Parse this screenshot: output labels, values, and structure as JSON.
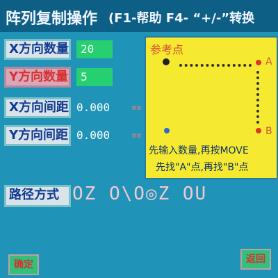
{
  "title": {
    "main": "阵列复制操作",
    "help": "(F1-帮助  F4- “+/-”转换"
  },
  "fields": [
    {
      "label": "X方向数量",
      "value": "20"
    },
    {
      "label": "Y方向数量",
      "value": "5"
    },
    {
      "label": "X方向间距",
      "value": "0.000",
      "unit": "mm"
    },
    {
      "label": "Y方向间距",
      "value": "0.000",
      "unit": "mm"
    }
  ],
  "path": {
    "label": "路径方式",
    "glyphs": "OZ O\\O◎Z OU"
  },
  "reference": {
    "title": "参考点",
    "point_a": "A",
    "point_b": "B",
    "instruction_1": "先输入数量,再按MOVE",
    "instruction_2": "先找\"A\"点,再找\"B\"点"
  },
  "buttons": {
    "confirm": "确定",
    "back": "返回"
  },
  "colors": {
    "background": "#1f93b8",
    "title_bar": "#0e5f86",
    "panel": "#f5ea30",
    "value_box": "#26d070",
    "accent_red": "#d83030"
  }
}
